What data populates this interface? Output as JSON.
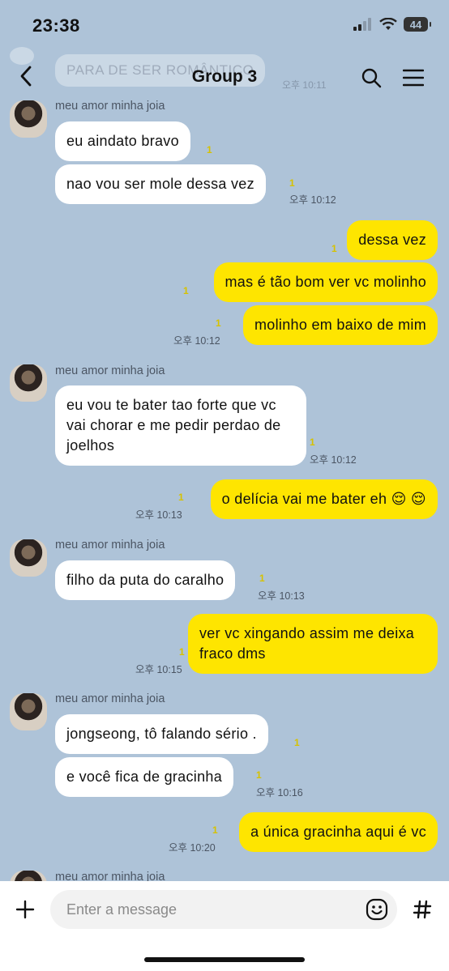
{
  "status_bar": {
    "time": "23:38",
    "battery": "44"
  },
  "header": {
    "title": "Group 3"
  },
  "faded_previous": {
    "text": "PARA DE SER ROMÂNTICO",
    "time": "오후 10:11"
  },
  "sender_name": "meu amor minha joia",
  "messages": [
    {
      "text": "eu aindato bravo",
      "unread": "1"
    },
    {
      "text": "nao vou ser mole dessa vez",
      "unread": "1",
      "time": "오후 10:12"
    },
    {
      "text": "dessa vez",
      "unread": "1"
    },
    {
      "text": "mas é tão bom ver vc molinho",
      "unread": "1"
    },
    {
      "text": "molinho em baixo de mim",
      "unread": "1",
      "time": "오후 10:12"
    },
    {
      "text": "eu vou te bater tao forte que vc vai chorar e me pedir perdao de joelhos",
      "unread": "1",
      "time": "오후 10:12"
    },
    {
      "text": "o delícia vai me bater eh 😌 😌",
      "unread": "1",
      "time": "오후 10:13"
    },
    {
      "text": "filho da puta do caralho",
      "unread": "1",
      "time": "오후 10:13"
    },
    {
      "text": "ver vc xingando assim me deixa fraco dms",
      "unread": "1",
      "time": "오후 10:15"
    },
    {
      "text": "jongseong, tô falando sério .",
      "unread": "1"
    },
    {
      "text": "e você fica de gracinha",
      "unread": "1",
      "time": "오후 10:16"
    },
    {
      "text": "a única gracinha aqui é vc",
      "unread": "1",
      "time": "오후 10:20"
    }
  ],
  "composer": {
    "placeholder": "Enter a message"
  },
  "icons": {
    "back": "chevron-left-icon",
    "search": "search-icon",
    "menu": "hamburger-menu-icon",
    "plus": "plus-icon",
    "emoji": "emoji-icon",
    "hash": "hash-icon"
  },
  "colors": {
    "background": "#aec3d8",
    "outgoing": "#fee500",
    "incoming": "#ffffff",
    "unread": "#d6c200"
  }
}
